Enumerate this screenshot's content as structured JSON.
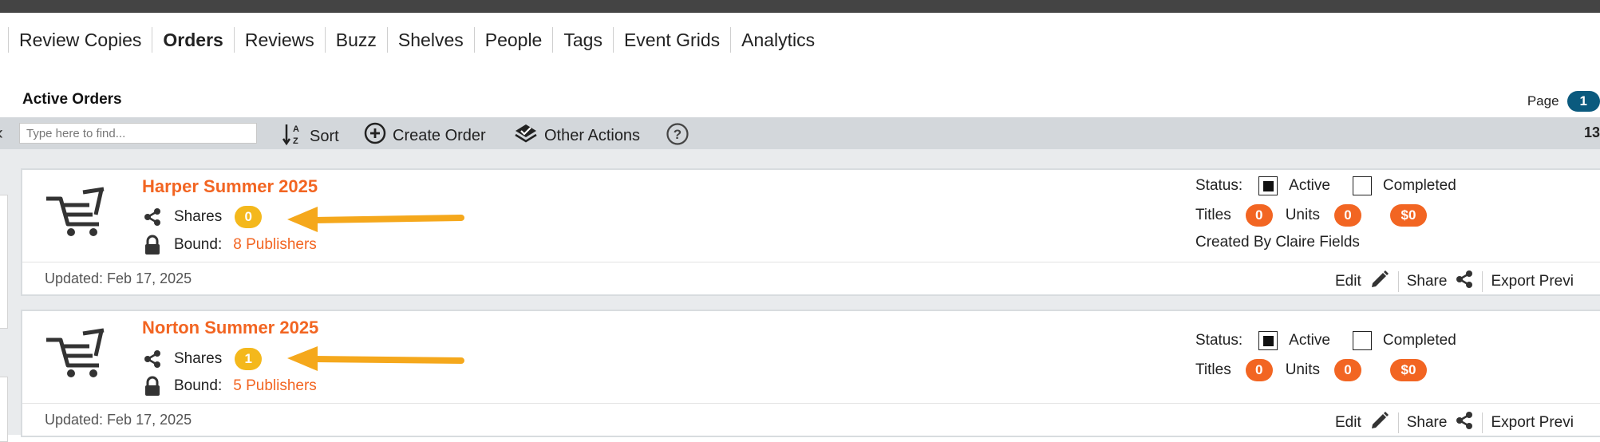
{
  "nav": {
    "items": [
      {
        "label": "Review Copies",
        "active": false
      },
      {
        "label": "Orders",
        "active": true
      },
      {
        "label": "Reviews",
        "active": false
      },
      {
        "label": "Buzz",
        "active": false
      },
      {
        "label": "Shelves",
        "active": false
      },
      {
        "label": "People",
        "active": false
      },
      {
        "label": "Tags",
        "active": false
      },
      {
        "label": "Event Grids",
        "active": false
      },
      {
        "label": "Analytics",
        "active": false
      }
    ]
  },
  "header": {
    "title": "Active Orders",
    "page_label": "Page",
    "page_number": "1"
  },
  "toolbar": {
    "search_placeholder": "Type here to find...",
    "sort_label": "Sort",
    "create_label": "Create Order",
    "other_label": "Other Actions",
    "count": "13"
  },
  "orders": [
    {
      "title": "Harper Summer 2025",
      "shares_label": "Shares",
      "shares_count": "0",
      "bound_label": "Bound:",
      "bound_value": "8 Publishers",
      "status_label": "Status:",
      "active_label": "Active",
      "active_checked": true,
      "completed_label": "Completed",
      "completed_checked": false,
      "titles_label": "Titles",
      "titles_count": "0",
      "units_label": "Units",
      "units_count": "0",
      "amount": "$0",
      "created_by": "Created By Claire Fields",
      "updated": "Updated: Feb 17, 2025",
      "edit_label": "Edit",
      "share_label": "Share",
      "export_label": "Export Previ"
    },
    {
      "title": "Norton Summer 2025",
      "shares_label": "Shares",
      "shares_count": "1",
      "bound_label": "Bound:",
      "bound_value": "5 Publishers",
      "status_label": "Status:",
      "active_label": "Active",
      "active_checked": true,
      "completed_label": "Completed",
      "completed_checked": false,
      "titles_label": "Titles",
      "titles_count": "0",
      "units_label": "Units",
      "units_count": "0",
      "amount": "$0",
      "updated": "Updated: Feb 17, 2025",
      "edit_label": "Edit",
      "share_label": "Share",
      "export_label": "Export Previ"
    }
  ],
  "colors": {
    "accent_orange": "#f26522",
    "badge_yellow": "#f4b81c",
    "arrow": "#f5a81c",
    "page_badge": "#0b5a7e",
    "toolbar_bg": "#d3d7db"
  }
}
